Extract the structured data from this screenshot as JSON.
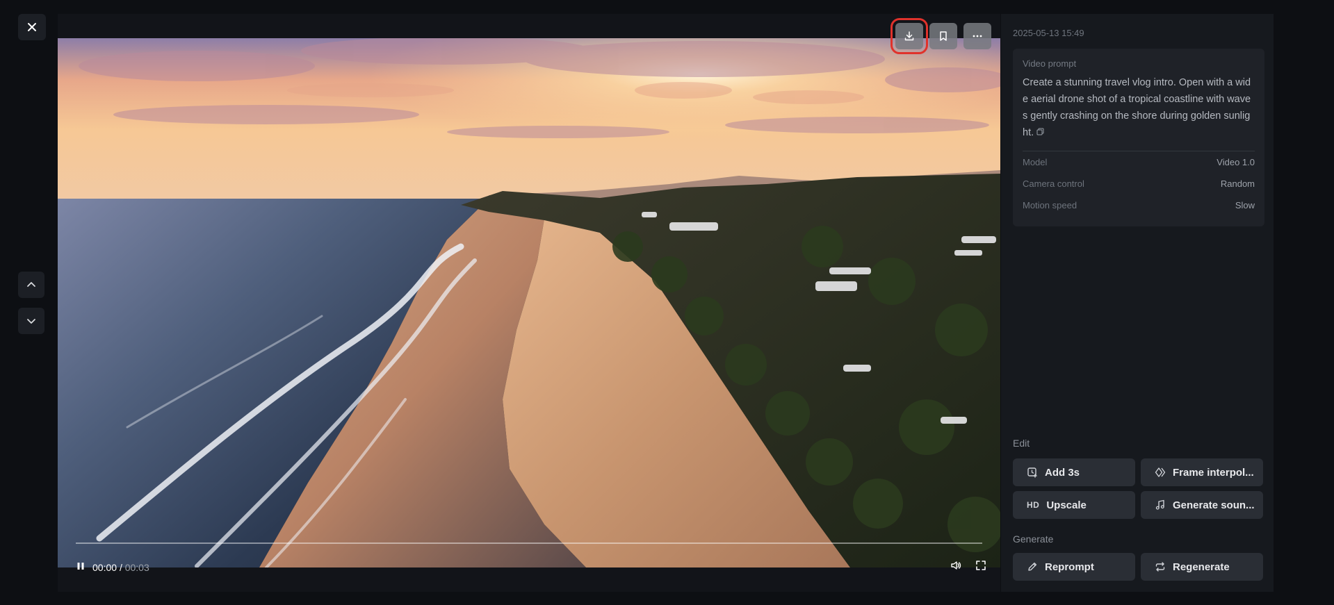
{
  "viewer": {
    "close_icon": "close-icon",
    "nav_up_icon": "chevron-up-icon",
    "nav_down_icon": "chevron-down-icon"
  },
  "player": {
    "actions": [
      {
        "name": "download-button",
        "icon": "download-icon",
        "highlighted": true
      },
      {
        "name": "bookmark-button",
        "icon": "bookmark-icon",
        "highlighted": false
      },
      {
        "name": "more-button",
        "icon": "more-icon",
        "highlighted": false
      }
    ],
    "time_current": "00:00",
    "time_separator": "/",
    "time_total": "00:03",
    "progress": 0,
    "play_state_icon": "pause-icon",
    "volume_icon": "volume-icon",
    "fullscreen_icon": "fullscreen-icon",
    "scene": "aerial view of a tropical beach coastline at golden sunset with waves and palm trees"
  },
  "details": {
    "timestamp": "2025-05-13 15:49",
    "prompt_label": "Video prompt",
    "prompt_text": "Create a stunning travel vlog intro. Open with a wide aerial drone shot of a tropical coastline with waves gently crashing on the shore during golden sunlight.",
    "copy_icon": "copy-icon",
    "meta": [
      {
        "key": "Model",
        "value": "Video 1.0"
      },
      {
        "key": "Camera control",
        "value": "Random"
      },
      {
        "key": "Motion speed",
        "value": "Slow"
      }
    ]
  },
  "edit": {
    "title": "Edit",
    "buttons": [
      {
        "label": "Add 3s",
        "icon": "add-time-icon"
      },
      {
        "label": "Frame interpolation",
        "display": "Frame interpol...",
        "icon": "frame-interpolation-icon"
      },
      {
        "label": "Upscale",
        "icon": "hd-icon",
        "glyph": "HD"
      },
      {
        "label": "Generate sound",
        "display": "Generate soun...",
        "icon": "music-note-icon"
      }
    ]
  },
  "generate": {
    "title": "Generate",
    "buttons": [
      {
        "label": "Reprompt",
        "icon": "pencil-icon"
      },
      {
        "label": "Regenerate",
        "icon": "repeat-icon"
      }
    ]
  },
  "colors": {
    "background": "#0d0f13",
    "panel": "#16191e",
    "button": "#2a2e35",
    "highlight": "#e0322b"
  }
}
